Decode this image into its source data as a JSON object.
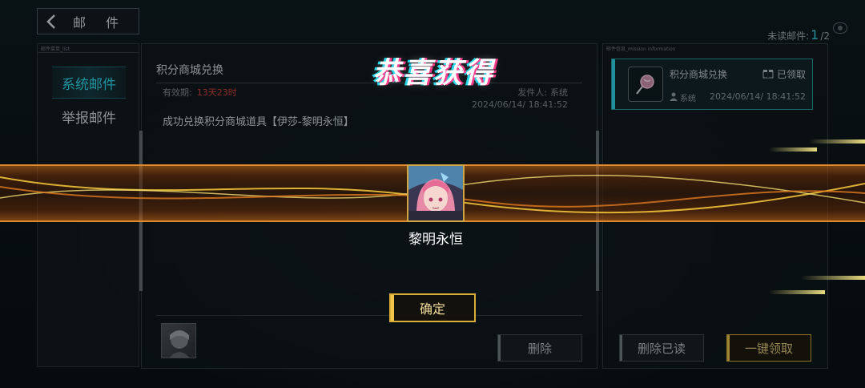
{
  "header": {
    "back_title": "邮 件",
    "unread_label": "未读邮件:",
    "unread_count": "1",
    "unread_total": "/2"
  },
  "left_panel": {
    "caption": "邮件菜单_list",
    "items": [
      {
        "label": "系统邮件",
        "active": true
      },
      {
        "label": "举报邮件",
        "active": false
      }
    ]
  },
  "mail": {
    "subject": "积分商城兑换",
    "validity_label": "有效期:",
    "validity_value": "13天23时",
    "sender_label": "发件人:",
    "sender_value": "系统",
    "date": "2024/06/14/ 18:41:52",
    "body": "成功兑换积分商城道具【伊莎-黎明永恒】",
    "delete_label": "删除"
  },
  "right_panel": {
    "caption": "邮件信息_mission information",
    "card": {
      "title": "积分商城兑换",
      "status": "已领取",
      "from": "系统",
      "date": "2024/06/14/ 18:41:52"
    },
    "delete_read_label": "删除已读",
    "claim_all_label": "一键领取"
  },
  "reward": {
    "title": "恭喜获得",
    "item_name": "黎明永恒",
    "confirm_label": "确定"
  },
  "colors": {
    "accent_cyan": "#2fd1e2",
    "gold": "#d9ad3a",
    "validity_red": "#c8423a",
    "band_orange": "#e0892a"
  }
}
